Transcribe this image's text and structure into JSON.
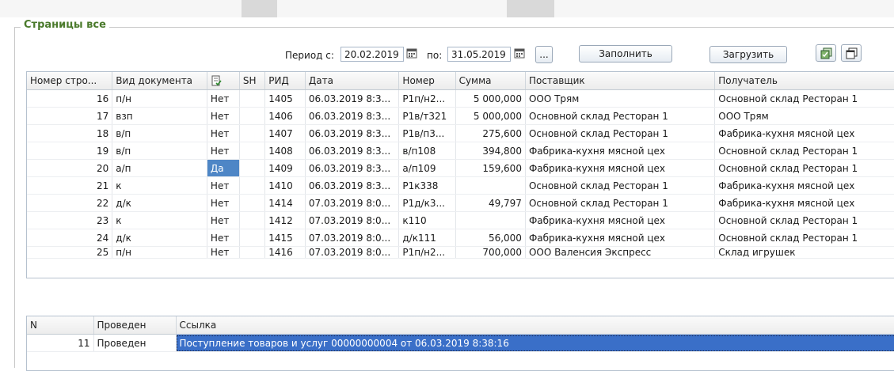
{
  "frame_title": "Страницы все",
  "toolbar": {
    "period_from_label": "Период с:",
    "period_from_value": "20.02.2019",
    "period_to_label": "по:",
    "period_to_value": "31.05.2019",
    "ellipsis_label": "...",
    "fill_label": "Заполнить",
    "load_label": "Загрузить"
  },
  "docs_table": {
    "headers": [
      "Номер стро...",
      "Вид документа",
      "",
      "SH",
      "РИД",
      "Дата",
      "Номер",
      "Сумма",
      "Поставщик",
      "Получатель"
    ],
    "rows": [
      [
        "16",
        "п/н",
        "Нет",
        "",
        "1405",
        "06.03.2019 8:3...",
        "Р1п/н2...",
        "5 000,000",
        "ООО Трям",
        "Основной склад Ресторан 1"
      ],
      [
        "17",
        "взп",
        "Нет",
        "",
        "1406",
        "06.03.2019 8:3...",
        "Р1в/т321",
        "5 000,000",
        "Основной склад Ресторан 1",
        "ООО Трям"
      ],
      [
        "18",
        "в/п",
        "Нет",
        "",
        "1407",
        "06.03.2019 8:3...",
        "Р1в/п3...",
        "275,600",
        "Основной склад Ресторан 1",
        "Фабрика-кухня мясной цех"
      ],
      [
        "19",
        "в/п",
        "Нет",
        "",
        "1408",
        "06.03.2019 8:3...",
        "в/п108",
        "394,800",
        "Фабрика-кухня мясной цех",
        "Основной склад Ресторан 1"
      ],
      [
        "20",
        "а/п",
        "Да",
        "",
        "1409",
        "06.03.2019 8:3...",
        "а/п109",
        "159,600",
        "Фабрика-кухня мясной цех",
        "Основной склад Ресторан 1"
      ],
      [
        "21",
        "к",
        "Нет",
        "",
        "1410",
        "06.03.2019 8:3...",
        "Р1к338",
        "",
        "Основной склад Ресторан 1",
        "Фабрика-кухня мясной цех"
      ],
      [
        "22",
        "д/к",
        "Нет",
        "",
        "1414",
        "07.03.2019 8:0...",
        "Р1д/к3...",
        "49,797",
        "Основной склад Ресторан 1",
        "Фабрика-кухня мясной цех"
      ],
      [
        "23",
        "к",
        "Нет",
        "",
        "1412",
        "07.03.2019 8:0...",
        "к110",
        "",
        "Фабрика-кухня мясной цех",
        "Основной склад Ресторан 1"
      ],
      [
        "24",
        "д/к",
        "Нет",
        "",
        "1415",
        "07.03.2019 8:0...",
        "д/к111",
        "56,000",
        "Фабрика-кухня мясной цех",
        "Основной склад Ресторан 1"
      ],
      [
        "25",
        "п/н",
        "Нет",
        "",
        "1416",
        "07.03.2019 8:0...",
        "Р1п/н2...",
        "700,000",
        "ООО Валенсия Экспресс",
        "Склад игрушек"
      ]
    ]
  },
  "links_table": {
    "headers": [
      "N",
      "Проведен",
      "Ссылка"
    ],
    "rows": [
      [
        "11",
        "Проведен",
        "Поступление товаров и услуг 00000000004 от 06.03.2019 8:38:16"
      ]
    ]
  },
  "colors": {
    "selection": "#4e86c6",
    "link_selection": "#3a6fc8",
    "title": "#4a7a2b"
  }
}
